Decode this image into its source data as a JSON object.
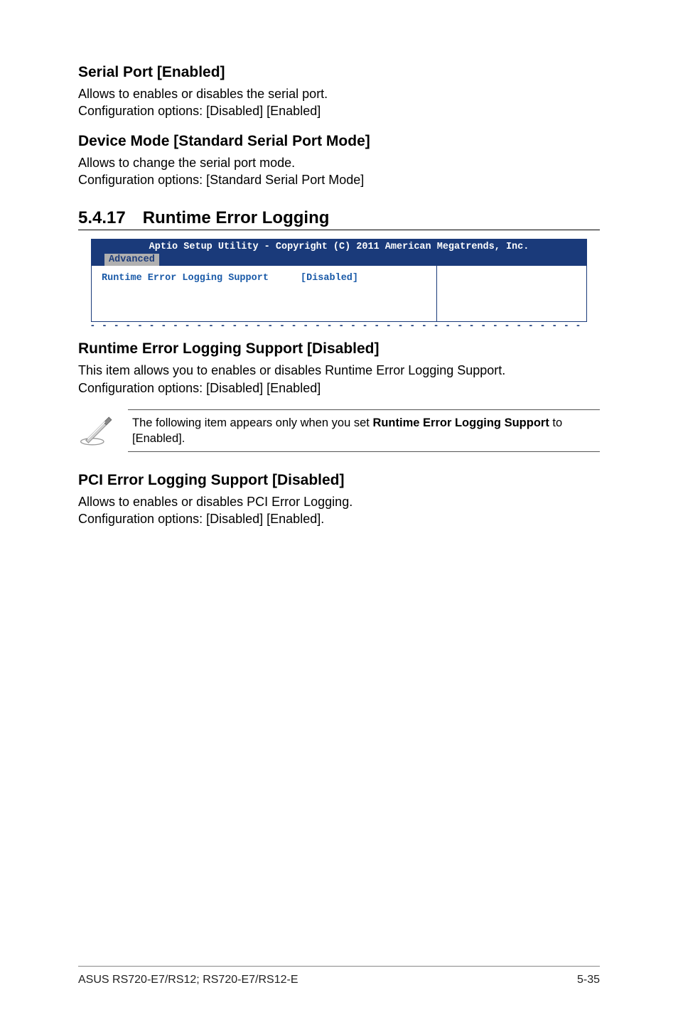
{
  "sections": {
    "serial_port": {
      "heading": "Serial Port [Enabled]",
      "line1": "Allows to enables or disables the serial port.",
      "line2": "Configuration options: [Disabled] [Enabled]"
    },
    "device_mode": {
      "heading": "Device Mode [Standard Serial Port Mode]",
      "line1": "Allows to change the serial port mode.",
      "line2": "Configuration options: [Standard Serial Port Mode]"
    },
    "runtime_section": {
      "number": "5.4.17",
      "title": "Runtime Error Logging"
    },
    "bios": {
      "title": "Aptio Setup Utility - Copyright (C) 2011 American Megatrends, Inc.",
      "tab": "Advanced",
      "setting_label": "Runtime Error Logging Support",
      "setting_value": "[Disabled]"
    },
    "runtime_support": {
      "heading": "Runtime Error Logging Support [Disabled]",
      "line1": "This item allows you to enables or disables Runtime Error Logging Support.",
      "line2": "Configuration options: [Disabled] [Enabled]"
    },
    "note": {
      "text_prefix": "The following item appears only when you set ",
      "bold": "Runtime Error Logging Support",
      "text_suffix": " to [Enabled]."
    },
    "pci_error": {
      "heading": "PCI Error Logging Support [Disabled]",
      "line1": "Allows to enables or disables PCI Error Logging.",
      "line2": "Configuration options: [Disabled] [Enabled]."
    }
  },
  "footer": {
    "left": "ASUS RS720-E7/RS12; RS720-E7/RS12-E",
    "right": "5-35"
  }
}
